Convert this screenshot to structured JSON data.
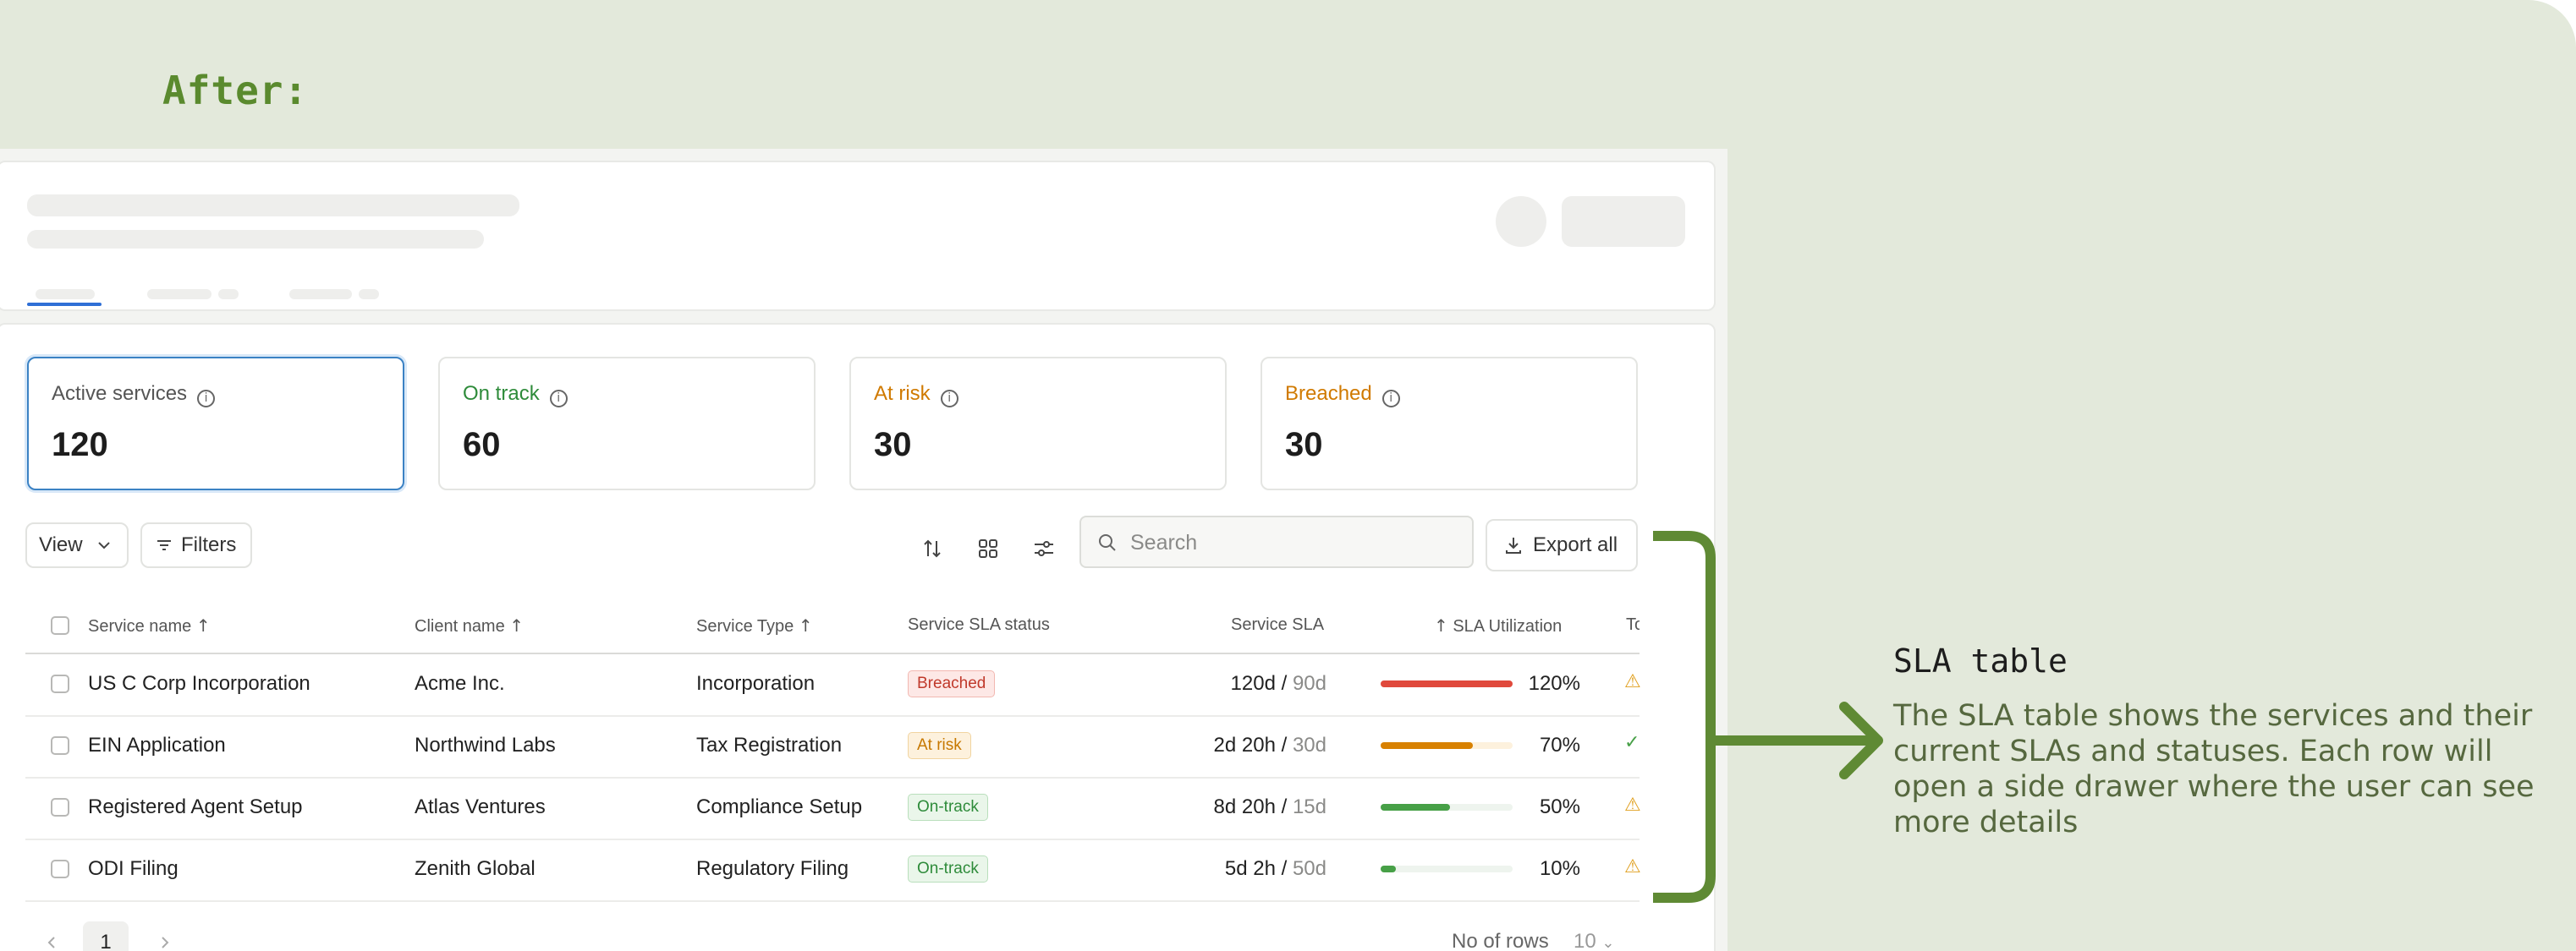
{
  "annotation": {
    "heading": "After:",
    "callout_title": "SLA table",
    "callout_description": "The SLA table shows the services and their current SLAs and statuses. Each row will open a side drawer where the user can see more details"
  },
  "stats": [
    {
      "label": "Active services",
      "value": "120",
      "color": "#555555"
    },
    {
      "label": "On track",
      "value": "60",
      "color": "#2e8b3a"
    },
    {
      "label": "At risk",
      "value": "30",
      "color": "#d07a00"
    },
    {
      "label": "Breached",
      "value": "30",
      "color": "#d07a00"
    }
  ],
  "toolbar": {
    "view_label": "View",
    "filters_label": "Filters",
    "search_placeholder": "Search",
    "export_label": "Export all",
    "icons": [
      "sort-icon",
      "grid-view-icon",
      "column-settings-icon"
    ]
  },
  "table": {
    "columns": [
      "Service name",
      "Client name",
      "Service Type",
      "Service SLA status",
      "Service SLA",
      "SLA Utilization",
      "To"
    ],
    "rows": [
      {
        "service": "US C Corp Incorporation",
        "client": "Acme Inc.",
        "type": "Incorporation",
        "status": "Breached",
        "sla_used": "120d",
        "sla_total": "90d",
        "utilization": "120%",
        "utilization_value": 1.0,
        "bar_color": "#e0493c",
        "icon": "warning-icon"
      },
      {
        "service": "EIN Application",
        "client": "Northwind Labs",
        "type": "Tax Registration",
        "status": "At risk",
        "sla_used": "2d 20h",
        "sla_total": "30d",
        "utilization": "70%",
        "utilization_value": 0.7,
        "bar_color": "#d88100",
        "icon": "check-circle-icon"
      },
      {
        "service": "Registered Agent Setup",
        "client": "Atlas Ventures",
        "type": "Compliance Setup",
        "status": "On-track",
        "sla_used": "8d 20h",
        "sla_total": "15d",
        "utilization": "50%",
        "utilization_value": 0.5,
        "bar_color": "#47a047",
        "icon": "warning-icon"
      },
      {
        "service": "ODI Filing",
        "client": "Zenith Global",
        "type": "Regulatory Filing",
        "status": "On-track",
        "sla_used": "5d 2h",
        "sla_total": "50d",
        "utilization": "10%",
        "utilization_value": 0.1,
        "bar_color": "#47a047",
        "icon": "warning-icon"
      }
    ]
  },
  "pagination": {
    "current_page": "1",
    "rows_label": "No of rows",
    "rows_value": "10"
  }
}
